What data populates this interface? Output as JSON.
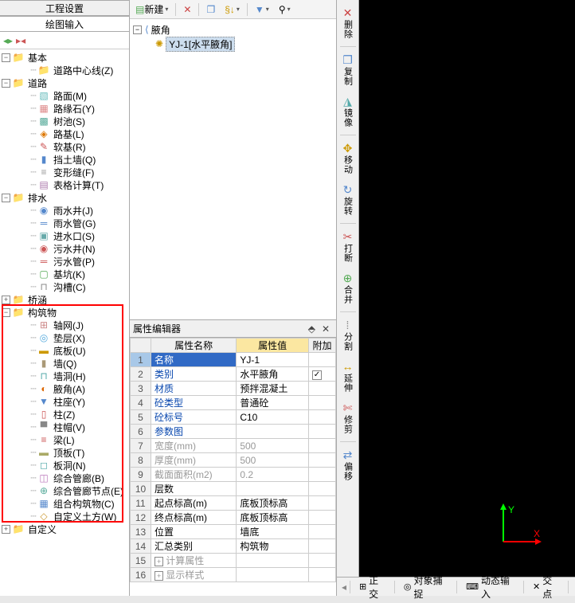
{
  "left": {
    "tab1": "工程设置",
    "tab2": "绘图输入",
    "tree": [
      {
        "d": 0,
        "exp": "-",
        "icon": "📁",
        "label": "基本",
        "cls": "folder-icon"
      },
      {
        "d": 1,
        "exp": "",
        "icon": "📁",
        "label": "道路中心线(Z)",
        "cls": "folder-icon"
      },
      {
        "d": 0,
        "exp": "-",
        "icon": "📁",
        "label": "道路",
        "cls": "folder-icon"
      },
      {
        "d": 1,
        "exp": "",
        "icon": "▧",
        "label": "路面(M)",
        "color": "#6bb"
      },
      {
        "d": 1,
        "exp": "",
        "icon": "▦",
        "label": "路缘石(Y)",
        "color": "#d88"
      },
      {
        "d": 1,
        "exp": "",
        "icon": "▩",
        "label": "树池(S)",
        "color": "#5a9"
      },
      {
        "d": 1,
        "exp": "",
        "icon": "◈",
        "label": "路基(L)",
        "color": "#d70"
      },
      {
        "d": 1,
        "exp": "",
        "icon": "✎",
        "label": "软基(R)",
        "color": "#c55"
      },
      {
        "d": 1,
        "exp": "",
        "icon": "▮",
        "label": "挡土墙(Q)",
        "color": "#58c"
      },
      {
        "d": 1,
        "exp": "",
        "icon": "≡",
        "label": "变形缝(F)",
        "color": "#999"
      },
      {
        "d": 1,
        "exp": "",
        "icon": "▤",
        "label": "表格计算(T)",
        "color": "#a7a"
      },
      {
        "d": 0,
        "exp": "-",
        "icon": "📁",
        "label": "排水",
        "cls": "folder-icon"
      },
      {
        "d": 1,
        "exp": "",
        "icon": "◉",
        "label": "雨水井(J)",
        "color": "#58c"
      },
      {
        "d": 1,
        "exp": "",
        "icon": "═",
        "label": "雨水管(G)",
        "color": "#58c"
      },
      {
        "d": 1,
        "exp": "",
        "icon": "▣",
        "label": "进水口(S)",
        "color": "#6aa"
      },
      {
        "d": 1,
        "exp": "",
        "icon": "◉",
        "label": "污水井(N)",
        "color": "#c55"
      },
      {
        "d": 1,
        "exp": "",
        "icon": "═",
        "label": "污水管(P)",
        "color": "#c55"
      },
      {
        "d": 1,
        "exp": "",
        "icon": "▢",
        "label": "基坑(K)",
        "color": "#5a5"
      },
      {
        "d": 1,
        "exp": "",
        "icon": "⊓",
        "label": "沟槽(C)",
        "color": "#888"
      },
      {
        "d": 0,
        "exp": "+",
        "icon": "📁",
        "label": "桥涵",
        "cls": "folder-icon"
      },
      {
        "d": 0,
        "exp": "-",
        "icon": "📁",
        "label": "构筑物",
        "cls": "folder-icon",
        "hl": true
      },
      {
        "d": 1,
        "exp": "",
        "icon": "⊞",
        "label": "轴网(J)",
        "color": "#c88",
        "hl": true
      },
      {
        "d": 1,
        "exp": "",
        "icon": "◎",
        "label": "垫层(X)",
        "color": "#5ad",
        "hl": true
      },
      {
        "d": 1,
        "exp": "",
        "icon": "▬",
        "label": "底板(U)",
        "color": "#c90",
        "hl": true
      },
      {
        "d": 1,
        "exp": "",
        "icon": "▮",
        "label": "墙(Q)",
        "color": "#a97",
        "hl": true
      },
      {
        "d": 1,
        "exp": "",
        "icon": "⊓",
        "label": "墙洞(H)",
        "color": "#5aa",
        "hl": true
      },
      {
        "d": 1,
        "exp": "",
        "icon": "◐",
        "label": "腋角(A)",
        "color": "#d60",
        "hl": true
      },
      {
        "d": 1,
        "exp": "",
        "icon": "▼",
        "label": "柱座(Y)",
        "color": "#58c",
        "hl": true
      },
      {
        "d": 1,
        "exp": "",
        "icon": "▯",
        "label": "柱(Z)",
        "color": "#c55",
        "hl": true
      },
      {
        "d": 1,
        "exp": "",
        "icon": "▀",
        "label": "柱帽(V)",
        "color": "#888",
        "hl": true
      },
      {
        "d": 1,
        "exp": "",
        "icon": "≡",
        "label": "梁(L)",
        "color": "#c55",
        "hl": true
      },
      {
        "d": 1,
        "exp": "",
        "icon": "▬",
        "label": "顶板(T)",
        "color": "#aa6",
        "hl": true
      },
      {
        "d": 1,
        "exp": "",
        "icon": "◻",
        "label": "板洞(N)",
        "color": "#5aa",
        "hl": true
      },
      {
        "d": 1,
        "exp": "",
        "icon": "◫",
        "label": "综合管廊(B)",
        "color": "#b7b",
        "hl": true
      },
      {
        "d": 1,
        "exp": "",
        "icon": "⊕",
        "label": "综合管廊节点(E)",
        "color": "#5a9",
        "hl": true
      },
      {
        "d": 1,
        "exp": "",
        "icon": "▦",
        "label": "组合构筑物(C)",
        "color": "#58c",
        "hl": true
      },
      {
        "d": 1,
        "exp": "",
        "icon": "◇",
        "label": "自定义土方(W)",
        "color": "#c93",
        "hl": true
      },
      {
        "d": 0,
        "exp": "+",
        "icon": "📁",
        "label": "自定义",
        "cls": "folder-icon"
      }
    ]
  },
  "mid": {
    "toolbar": {
      "new": "新建"
    },
    "tree_root": "腋角",
    "tree_item": "YJ-1[水平腋角]",
    "prop_title": "属性编辑器",
    "headers": {
      "name": "属性名称",
      "value": "属性值",
      "extra": "附加"
    },
    "rows": [
      {
        "n": "1",
        "name": "名称",
        "val": "YJ-1",
        "blue": false,
        "gray": false,
        "active": true
      },
      {
        "n": "2",
        "name": "类别",
        "val": "水平腋角",
        "blue": true,
        "chk": true
      },
      {
        "n": "3",
        "name": "材质",
        "val": "预拌混凝土",
        "blue": true
      },
      {
        "n": "4",
        "name": "砼类型",
        "val": "普通砼",
        "blue": true
      },
      {
        "n": "5",
        "name": "砼标号",
        "val": "C10",
        "blue": true
      },
      {
        "n": "6",
        "name": "参数图",
        "val": "",
        "blue": true
      },
      {
        "n": "7",
        "name": "宽度(mm)",
        "val": "500",
        "gray": true
      },
      {
        "n": "8",
        "name": "厚度(mm)",
        "val": "500",
        "gray": true
      },
      {
        "n": "9",
        "name": "截面面积(m2)",
        "val": "0.2",
        "gray": true
      },
      {
        "n": "10",
        "name": "层数",
        "val": ""
      },
      {
        "n": "11",
        "name": "起点标高(m)",
        "val": "底板顶标高"
      },
      {
        "n": "12",
        "name": "终点标高(m)",
        "val": "底板顶标高"
      },
      {
        "n": "13",
        "name": "位置",
        "val": "墙底"
      },
      {
        "n": "14",
        "name": "汇总类别",
        "val": "构筑物"
      },
      {
        "n": "15",
        "name": "计算属性",
        "val": "",
        "exp": "+",
        "gray": true
      },
      {
        "n": "16",
        "name": "显示样式",
        "val": "",
        "exp": "+",
        "gray": true
      }
    ]
  },
  "right": {
    "buttons": [
      {
        "icon": "✕",
        "label": "删除",
        "color": "#c44"
      },
      {
        "sep": true
      },
      {
        "icon": "❐",
        "label": "复制",
        "color": "#58c"
      },
      {
        "icon": "◮",
        "label": "镜像",
        "color": "#5aa"
      },
      {
        "sep": true
      },
      {
        "icon": "✥",
        "label": "移动",
        "color": "#c90"
      },
      {
        "icon": "↻",
        "label": "旋转",
        "color": "#58c"
      },
      {
        "sep": true
      },
      {
        "icon": "✂",
        "label": "打断",
        "color": "#c55"
      },
      {
        "icon": "⊕",
        "label": "合并",
        "color": "#5a5"
      },
      {
        "sep": true
      },
      {
        "icon": "⁞",
        "label": "分割",
        "color": "#888"
      },
      {
        "icon": "↔",
        "label": "延伸",
        "color": "#c90"
      },
      {
        "icon": "✄",
        "label": "修剪",
        "color": "#c55"
      },
      {
        "sep": true
      },
      {
        "icon": "⇄",
        "label": "偏移",
        "color": "#58c"
      }
    ],
    "status": [
      {
        "icon": "⊞",
        "label": "正交"
      },
      {
        "icon": "◎",
        "label": "对象捕捉"
      },
      {
        "icon": "⌨",
        "label": "动态输入"
      },
      {
        "icon": "✕",
        "label": "交点"
      }
    ],
    "axis": {
      "x": "X",
      "y": "Y"
    }
  }
}
